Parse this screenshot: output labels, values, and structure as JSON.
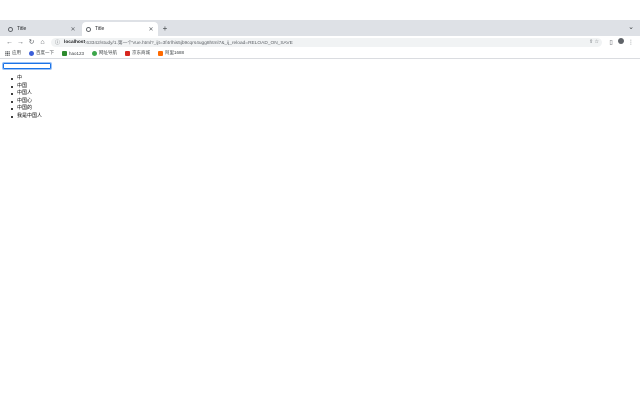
{
  "browser": {
    "tabs": [
      {
        "title": "Title",
        "active": false
      },
      {
        "title": "Title",
        "active": true
      }
    ],
    "new_tab": "+",
    "tab_search": "⌄",
    "url_host": "localhost",
    "url_rest": ":63342/study/1.第一个Vue.html?_ijt=3f4rlhis5jb9cqrs4ugg8html7&_ij_reload=RELOAD_ON_SAVE",
    "bookmarks": [
      {
        "label": "应用",
        "icon": "apps-grid-icon"
      },
      {
        "label": "百度一下",
        "icon": "baidu-icon",
        "color": "#3b5fd9"
      },
      {
        "label": "hao123",
        "icon": "hao123-icon",
        "color": "#2e8b2e"
      },
      {
        "label": "网址导航",
        "icon": "nav-icon",
        "color": "#3ca64a"
      },
      {
        "label": "京东商城",
        "icon": "jd-icon",
        "color": "#d7261e"
      },
      {
        "label": "阿里1688",
        "icon": "ali1688-icon",
        "color": "#ff6a00"
      }
    ]
  },
  "page": {
    "input_value": "",
    "items": [
      "中",
      "中国",
      "中国人",
      "中国心",
      "中国的",
      "我是中国人"
    ]
  }
}
